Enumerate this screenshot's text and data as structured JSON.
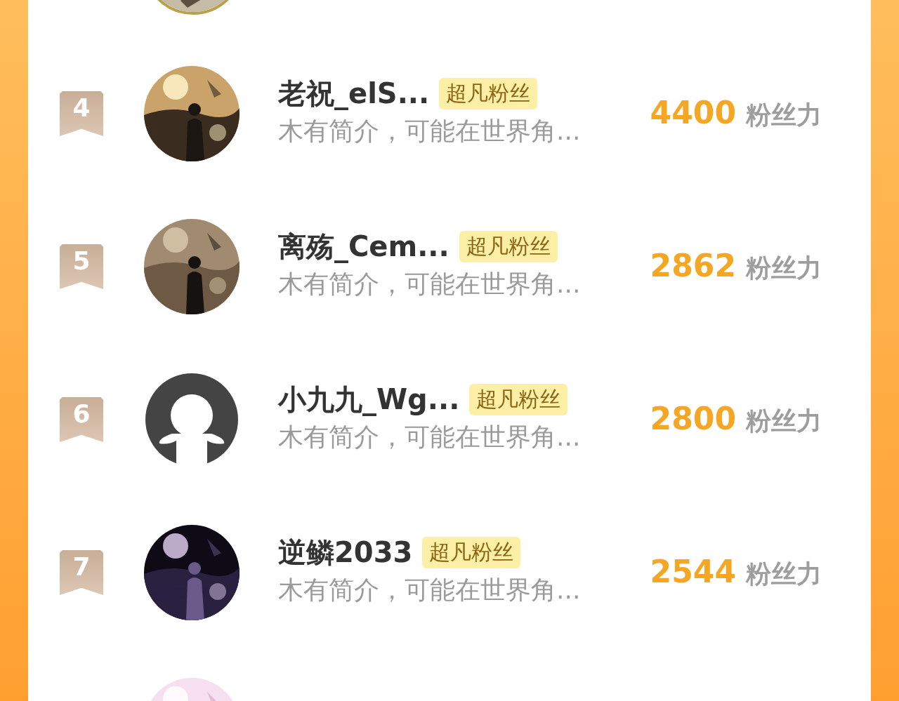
{
  "fans": [
    {
      "rank": "4",
      "avatar": {
        "kind": "picture"
      },
      "name": "老祝_elS...",
      "badge": "超凡粉丝",
      "bio": "木有简介，可能在世界角...",
      "score": "4400",
      "score_unit": "粉丝力"
    },
    {
      "rank": "5",
      "avatar": {
        "kind": "picture"
      },
      "name": "离殇_Cem...",
      "badge": "超凡粉丝",
      "bio": "木有简介，可能在世界角...",
      "score": "2862",
      "score_unit": "粉丝力"
    },
    {
      "rank": "6",
      "avatar": {
        "kind": "default"
      },
      "name": "小九九_Wg...",
      "badge": "超凡粉丝",
      "bio": "木有简介，可能在世界角...",
      "score": "2800",
      "score_unit": "粉丝力"
    },
    {
      "rank": "7",
      "avatar": {
        "kind": "picture"
      },
      "name": "逆鳞2033",
      "badge": "超凡粉丝",
      "bio": "木有简介，可能在世界角...",
      "score": "2544",
      "score_unit": "粉丝力"
    },
    {
      "avatar": {
        "kind": "picture"
      }
    }
  ]
}
